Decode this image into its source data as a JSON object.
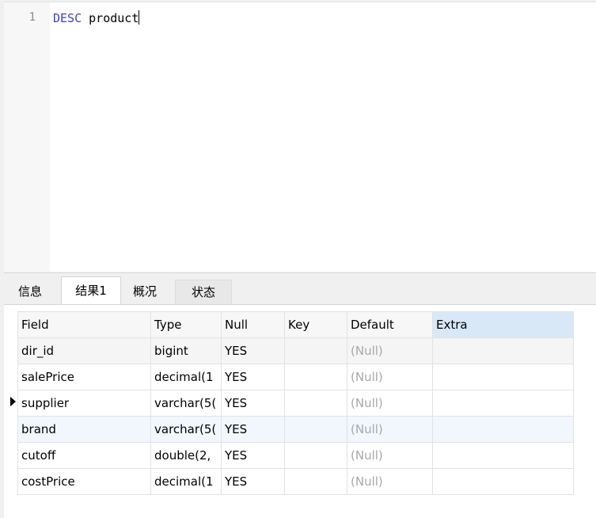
{
  "editor": {
    "line_number": "1",
    "keyword": "DESC",
    "identifier": "product"
  },
  "tabs": [
    {
      "label": "信息"
    },
    {
      "label": "结果1"
    },
    {
      "label": "概况"
    },
    {
      "label": "状态"
    }
  ],
  "grid": {
    "columns": [
      "Field",
      "Type",
      "Null",
      "Key",
      "Default",
      "Extra"
    ],
    "rows": [
      {
        "field": "dir_id",
        "type": "bigint",
        "null": "YES",
        "key": "",
        "default": "(Null)",
        "extra": ""
      },
      {
        "field": "salePrice",
        "type": "decimal(1",
        "null": "YES",
        "key": "",
        "default": "(Null)",
        "extra": ""
      },
      {
        "field": "supplier",
        "type": "varchar(5(",
        "null": "YES",
        "key": "",
        "default": "(Null)",
        "extra": ""
      },
      {
        "field": "brand",
        "type": "varchar(5(",
        "null": "YES",
        "key": "",
        "default": "(Null)",
        "extra": ""
      },
      {
        "field": "cutoff",
        "type": "double(2,",
        "null": "YES",
        "key": "",
        "default": "(Null)",
        "extra": ""
      },
      {
        "field": "costPrice",
        "type": "decimal(1",
        "null": "YES",
        "key": "",
        "default": "(Null)",
        "extra": ""
      }
    ]
  },
  "colors": {
    "keyword": "#3a43d6",
    "sorted_header": "#d8e8f7",
    "null_text": "#a8a8a8"
  }
}
